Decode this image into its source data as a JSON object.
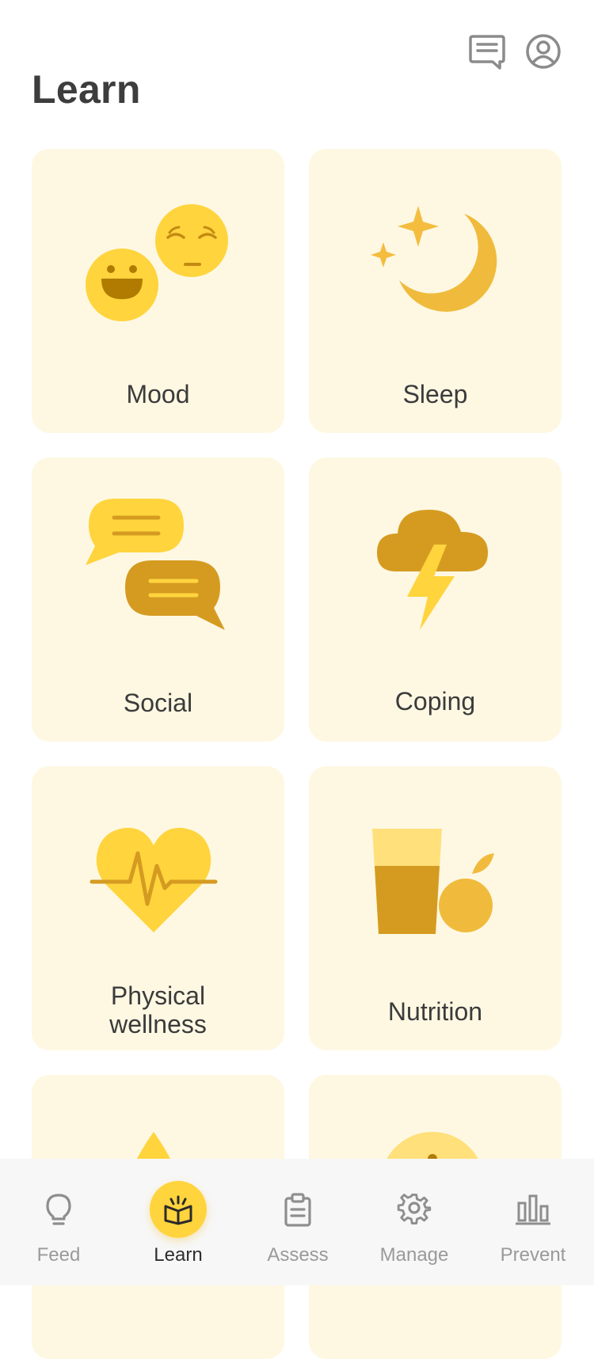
{
  "header": {
    "title": "Learn",
    "icons": [
      "chat-icon",
      "profile-icon"
    ]
  },
  "cards": [
    {
      "label": "Mood",
      "icon": "mood-faces-icon"
    },
    {
      "label": "Sleep",
      "icon": "moon-stars-icon"
    },
    {
      "label": "Social",
      "icon": "speech-bubbles-icon"
    },
    {
      "label": "Coping",
      "icon": "storm-cloud-icon"
    },
    {
      "label": "Physical\nwellness",
      "icon": "heart-pulse-icon"
    },
    {
      "label": "Nutrition",
      "icon": "glass-orange-icon"
    },
    {
      "label": "",
      "icon": "drop-icon"
    },
    {
      "label": "",
      "icon": "sun-face-icon"
    }
  ],
  "nav": {
    "items": [
      {
        "label": "Feed",
        "icon": "lightbulb-icon"
      },
      {
        "label": "Learn",
        "icon": "open-book-icon",
        "active": true
      },
      {
        "label": "Assess",
        "icon": "clipboard-icon"
      },
      {
        "label": "Manage",
        "icon": "gear-icon"
      },
      {
        "label": "Prevent",
        "icon": "bar-chart-icon"
      }
    ]
  },
  "colors": {
    "card_bg": "#fef8e3",
    "accent": "#ffd43d",
    "dark_gold": "#d59b21",
    "mid_gold": "#f0bb3c",
    "nav_bg": "#f7f7f7"
  }
}
